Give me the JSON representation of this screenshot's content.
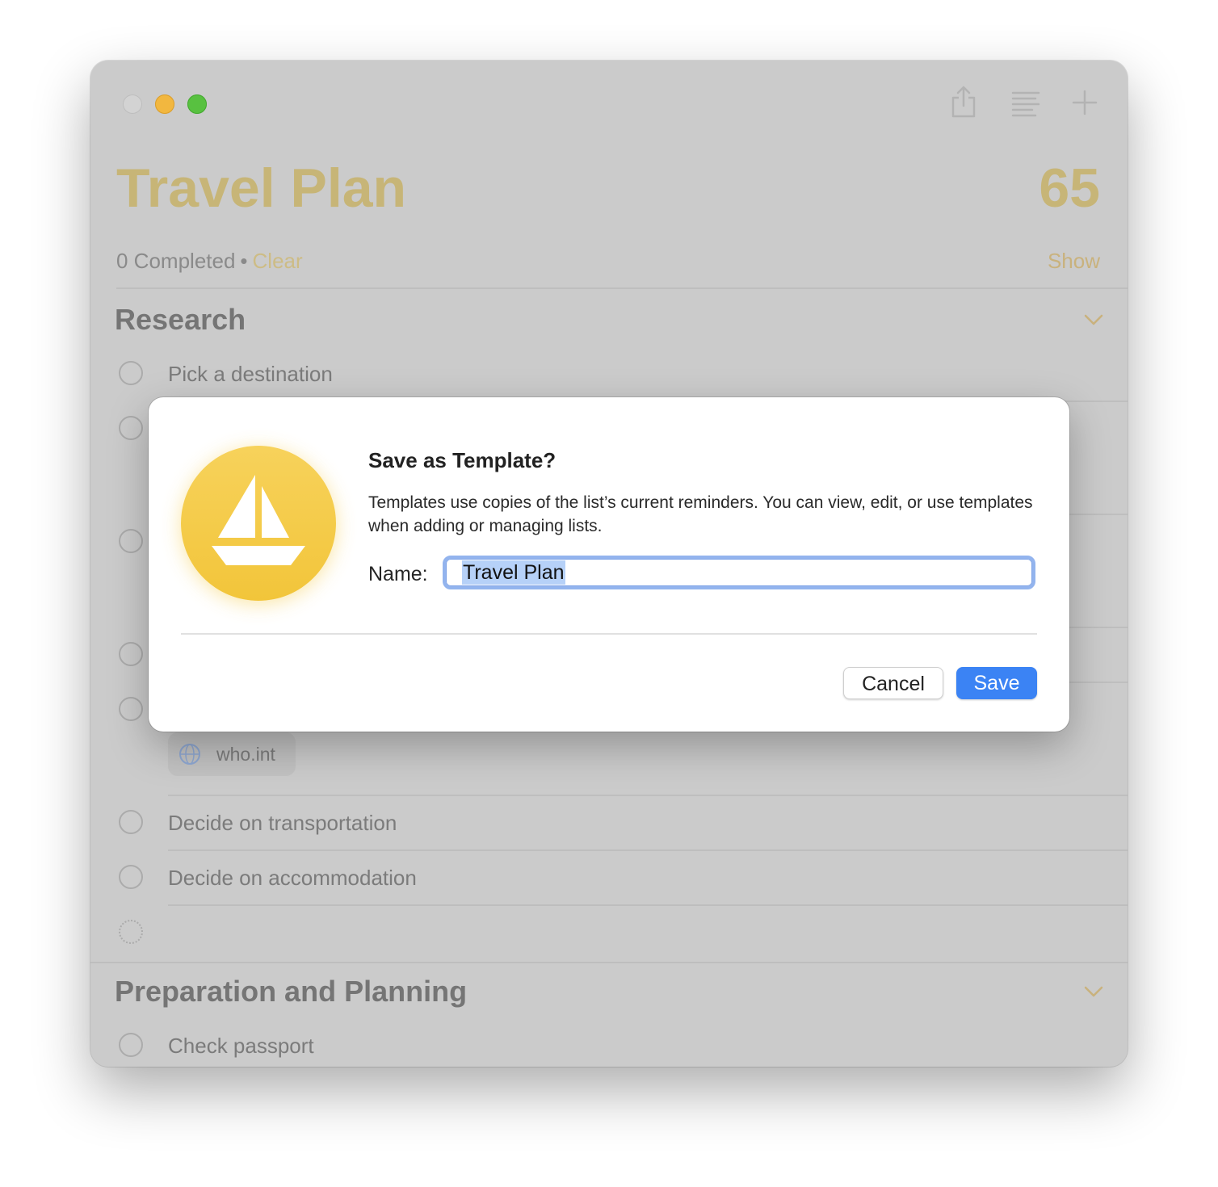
{
  "list": {
    "title": "Travel Plan",
    "count": "65",
    "completed": "0 Completed",
    "separator": "•",
    "clear_label": "Clear",
    "show_label": "Show"
  },
  "toolbar": {
    "icons": [
      "share-icon",
      "list-format-icon",
      "plus-icon"
    ]
  },
  "sections": [
    {
      "title": "Research",
      "items": [
        "Pick a destination",
        "Decide on transportation",
        "Decide on accommodation"
      ],
      "link_chip": "who.int"
    },
    {
      "title": "Preparation and Planning",
      "items": [
        "Check passport"
      ]
    }
  ],
  "dialog": {
    "title": "Save as Template?",
    "message": "Templates use copies of the list’s current reminders. You can view, edit, or use templates when adding or managing lists.",
    "name_label": "Name:",
    "name_value": "Travel Plan",
    "cancel_label": "Cancel",
    "save_label": "Save",
    "icon": "sailboat-icon"
  },
  "colors": {
    "accent": "#c7b577",
    "save_button": "#3b83f4",
    "focus_ring": "#93b4ee",
    "app_icon": "#f2c53a"
  }
}
